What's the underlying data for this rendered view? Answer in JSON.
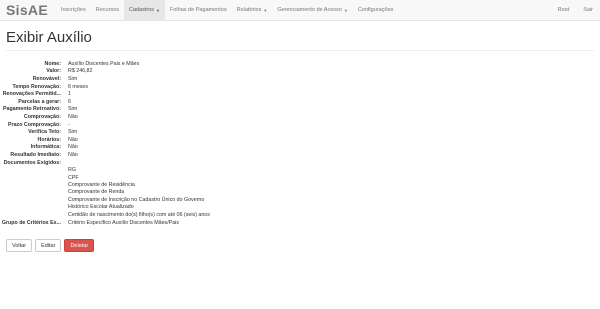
{
  "navbar": {
    "brand": "SisAE",
    "items": [
      {
        "label": "Inscrições",
        "dropdown": false,
        "active": false
      },
      {
        "label": "Recursos",
        "dropdown": false,
        "active": false
      },
      {
        "label": "Cadastros",
        "dropdown": true,
        "active": true
      },
      {
        "label": "Folhas de Pagamentos",
        "dropdown": false,
        "active": false
      },
      {
        "label": "Relatórios",
        "dropdown": true,
        "active": false
      },
      {
        "label": "Gerenciamento de Acesso",
        "dropdown": true,
        "active": false
      },
      {
        "label": "Configurações",
        "dropdown": false,
        "active": false
      }
    ],
    "right": [
      "Root",
      "Sair"
    ]
  },
  "page": {
    "title": "Exibir Auxílio"
  },
  "details": [
    {
      "label": "Nome:",
      "value": "Auxílio Discentes Pais e Mães"
    },
    {
      "label": "Valor:",
      "value": "R$ 246,82"
    },
    {
      "label": "Renovável:",
      "value": "Sim"
    },
    {
      "label": "Tempo Renovação:",
      "value": "6 meses"
    },
    {
      "label": "Renovações Permitid...",
      "value": "1"
    },
    {
      "label": "Parcelas a gerar:",
      "value": "6"
    },
    {
      "label": "Pagamento Retroativo:",
      "value": "Sim"
    },
    {
      "label": "Comprovação:",
      "value": "Não"
    },
    {
      "label": "Prazo Comprovação:",
      "value": "-"
    },
    {
      "label": "Verifica Teto:",
      "value": "Sim"
    },
    {
      "label": "Horários:",
      "value": "Não"
    },
    {
      "label": "Informática:",
      "value": "Não"
    },
    {
      "label": "Resultado Imediato:",
      "value": "Não"
    },
    {
      "label": "Documentos Exigidos:",
      "value": ""
    }
  ],
  "documents": [
    "RG",
    "CPF",
    "Comprovante de Residência",
    "Comprovante de Renda",
    "Comprovante de Inscrição no Cadastro Único do Governo",
    "Histórico Escolar Atualizado",
    "Certidão de nascimento do(s) filho(s) com até 06 (seis) anos"
  ],
  "criteria": {
    "label": "Grupo de Critérios Es...",
    "value": "Critério Específico Auxílio Discentes Mães/Pais"
  },
  "actions": {
    "back": "Voltar",
    "edit": "Editar",
    "delete": "Deletar"
  }
}
